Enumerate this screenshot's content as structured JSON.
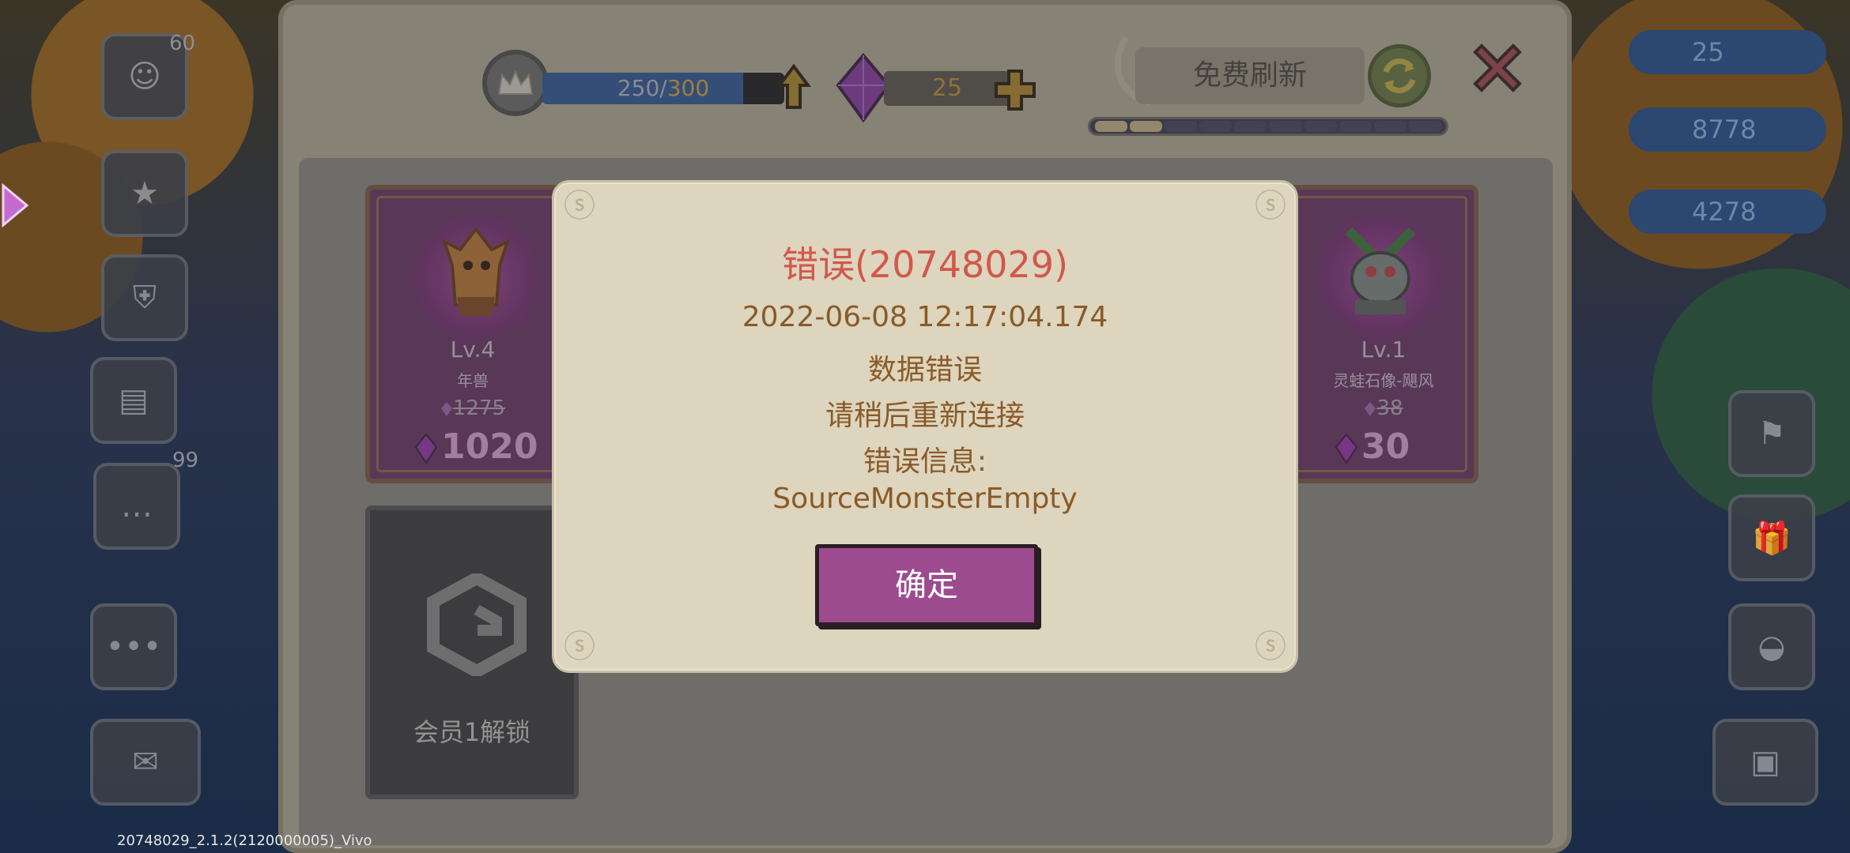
{
  "background": {
    "badge_count": "60",
    "side_count": "99",
    "right_counters": [
      "25",
      "8778",
      "4278"
    ]
  },
  "shop": {
    "xp_current": "250",
    "xp_separator": "/",
    "xp_max": "300",
    "xp_fraction": 0.83,
    "gem_count": "25",
    "free_refresh_label": "免费刷新",
    "refresh_progress_filled": 2,
    "refresh_progress_total": 10,
    "cards": [
      {
        "level": "Lv.4",
        "name": "年兽",
        "old_price": "1275",
        "price": "1020"
      },
      {
        "level": "Lv.1",
        "name": "灵蛙石像-飓风",
        "old_price": "38",
        "price": "30"
      }
    ],
    "locked_card_label": "会员1解锁"
  },
  "dialog": {
    "title": "错误(20748029)",
    "timestamp": "2022-06-08 12:17:04.174",
    "line_data_error": "数据错误",
    "line_reconnect": "请稍后重新连接",
    "line_error_info": "错误信息:",
    "line_source": "SourceMonsterEmpty",
    "confirm_label": "确定"
  },
  "build_info": "20748029_2.1.2(2120000005)_Vivo",
  "colors": {
    "accent_purple": "#9c4b8f",
    "error_red": "#d2574c",
    "text_brown": "#8a5a28",
    "gem_purple": "#9a35b5"
  }
}
